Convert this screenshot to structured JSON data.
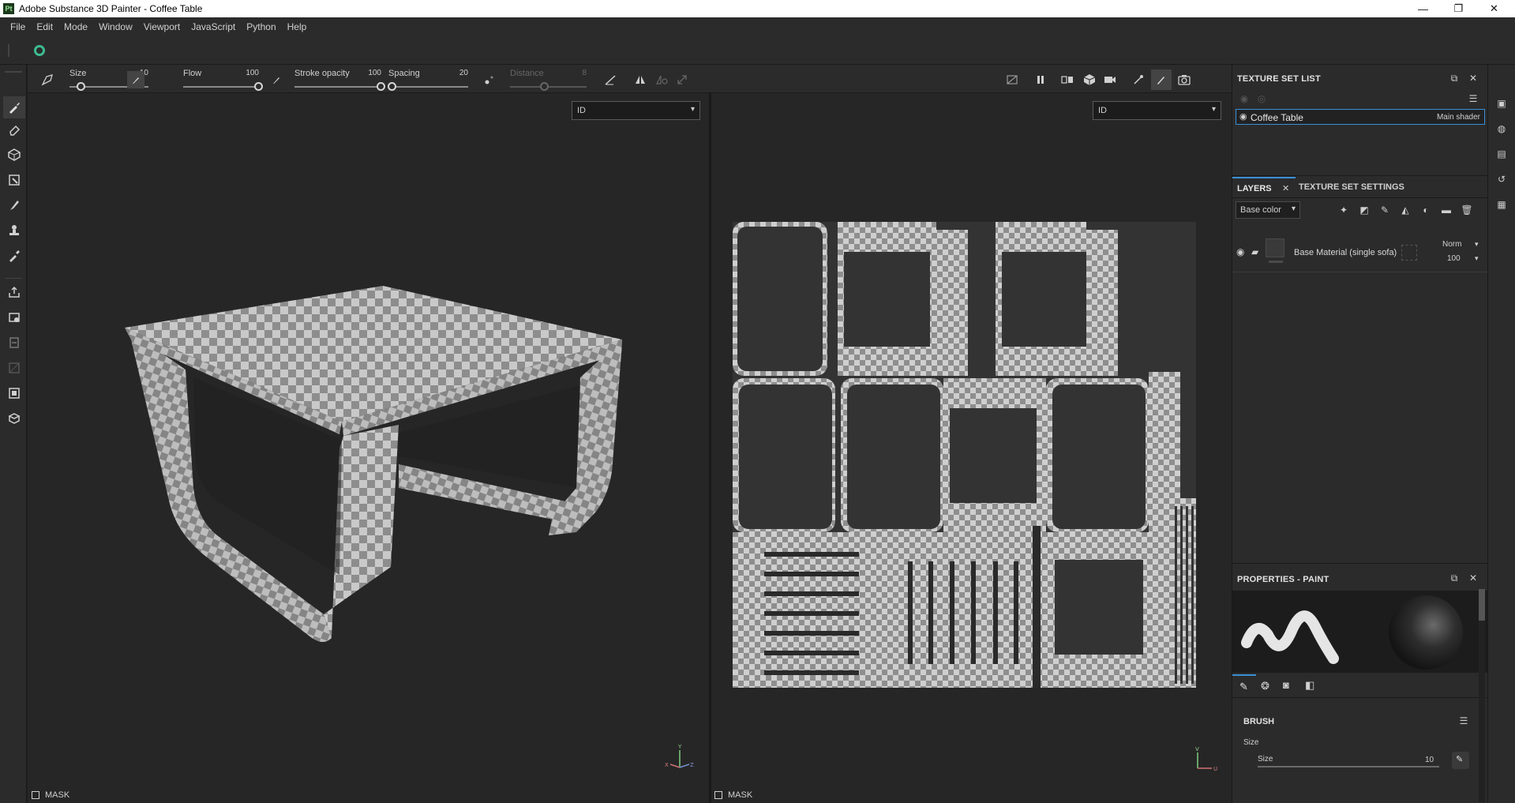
{
  "window": {
    "title": "Adobe Substance 3D Painter - Coffee Table",
    "app_badge": "Pt",
    "controls": [
      "—",
      "❐",
      "✕"
    ]
  },
  "menu": [
    "File",
    "Edit",
    "Mode",
    "Window",
    "Viewport",
    "JavaScript",
    "Python",
    "Help"
  ],
  "tool_options": {
    "size": {
      "label": "Size",
      "value": "10",
      "fraction": 0.15
    },
    "flow": {
      "label": "Flow",
      "value": "100",
      "fraction": 1.0
    },
    "stroke_opacity": {
      "label": "Stroke opacity",
      "value": "100",
      "fraction": 1.0
    },
    "spacing": {
      "label": "Spacing",
      "value": "20",
      "fraction": 0.05
    },
    "distance": {
      "label": "Distance",
      "value": "8",
      "fraction": 0.45
    }
  },
  "viewports": {
    "left": {
      "channel": "ID",
      "mask_label": "MASK"
    },
    "right": {
      "channel": "ID",
      "mask_label": "MASK"
    }
  },
  "texture_set_list": {
    "title": "TEXTURE SET LIST",
    "item_name": "Coffee Table",
    "item_shader": "Main shader"
  },
  "layers": {
    "tab_layers": "LAYERS",
    "tab_settings": "TEXTURE SET SETTINGS",
    "channel": "Base color",
    "layer_name": "Base Material (single sofa)",
    "blend_mode": "Norm",
    "opacity": "100"
  },
  "properties": {
    "title": "PROPERTIES - PAINT",
    "section": "BRUSH",
    "group_label": "Size",
    "param_label": "Size",
    "param_value": "10"
  },
  "colors": {
    "accent": "#3a8fd6",
    "panel": "#2b2b2b",
    "viewport": "#262626"
  }
}
